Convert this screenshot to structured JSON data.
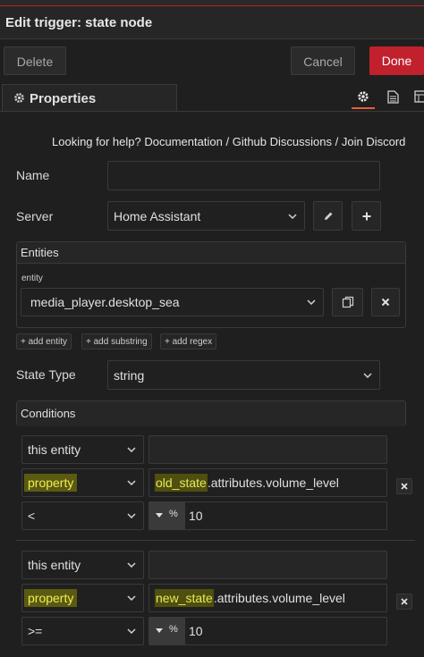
{
  "dialog": {
    "title": "Edit trigger: state node"
  },
  "toolbar": {
    "delete_label": "Delete",
    "cancel_label": "Cancel",
    "done_label": "Done"
  },
  "tabs": {
    "properties_label": "Properties",
    "active_icon": "gear-icon",
    "other_icons": [
      "document-icon",
      "grid-icon"
    ]
  },
  "help": {
    "prefix": "Looking for help?",
    "links": [
      "Documentation",
      "Github Discussions",
      "Join Discord"
    ],
    "separator": "/"
  },
  "form": {
    "name": {
      "label": "Name",
      "value": ""
    },
    "server": {
      "label": "Server",
      "value": "Home Assistant"
    },
    "entities": {
      "header": "Entities",
      "entity_label": "entity",
      "entity_value": "media_player.desktop_sea",
      "buttons": [
        "+ add entity",
        "+ add substring",
        "+ add regex"
      ]
    },
    "state_type": {
      "label": "State Type",
      "value": "string"
    },
    "conditions": {
      "header": "Conditions",
      "items": [
        {
          "target": "this entity",
          "target_value": "",
          "prop_type": "property",
          "prop_highlight": "old_state",
          "prop_rest": ".attributes.volume_level",
          "operator": "<",
          "value_type_icon": "%",
          "value": "10"
        },
        {
          "target": "this entity",
          "target_value": "",
          "prop_type": "property",
          "prop_highlight": "new_state",
          "prop_rest": ".attributes.volume_level",
          "operator": ">=",
          "value_type_icon": "%",
          "value": "10"
        }
      ]
    }
  },
  "colors": {
    "accent": "#c0212d",
    "tab_indicator": "#e0603a",
    "highlight": "#5a5a12"
  }
}
